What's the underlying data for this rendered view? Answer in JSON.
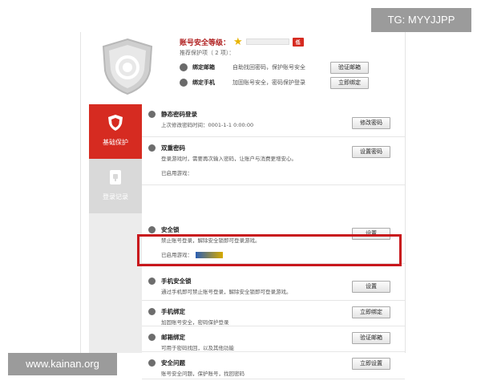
{
  "watermarks": {
    "tg": "TG: MYYJJPP",
    "site": "www.kainan.org"
  },
  "header": {
    "level_label": "账号安全等级：",
    "level_tag": "低",
    "recommend": "推荐保护项（ 2 项）：",
    "binds": [
      {
        "label": "绑定邮箱",
        "desc": "自助找回密码，保护账号安全",
        "button": "验证邮箱"
      },
      {
        "label": "绑定手机",
        "desc": "加固账号安全，密码保护登录",
        "button": "立即绑定"
      }
    ]
  },
  "sidebar": {
    "items": [
      {
        "label": "基础保护"
      },
      {
        "label": "登录记录"
      }
    ]
  },
  "rows": [
    {
      "title": "静态密码登录",
      "desc": "上次修改密码时间：0001-1-1 0:00:00",
      "button": "修改密码"
    },
    {
      "title": "双重密码",
      "desc": "登录游戏时，需要再次输入密码，让账户与消费更增安心。",
      "extra": "已启用游戏：",
      "button": "设置密码"
    },
    {
      "title": "安全锁",
      "desc": "禁止账号登录，解除安全锁即可登录游戏。",
      "extra": "已启用游戏：",
      "button": "设置"
    },
    {
      "title": "手机安全锁",
      "desc": "通过手机即可禁止账号登录，解除安全锁即可登录游戏。",
      "button": "设置"
    },
    {
      "title": "手机绑定",
      "desc": "加固账号安全，密码保护登录",
      "button": "立即绑定"
    },
    {
      "title": "邮箱绑定",
      "desc": "可用于密码找回，以及其他功能",
      "button": "验证邮箱"
    },
    {
      "title": "安全问题",
      "desc": "账号安全问题，保护账号，找回密码",
      "button": "立即设置"
    }
  ]
}
